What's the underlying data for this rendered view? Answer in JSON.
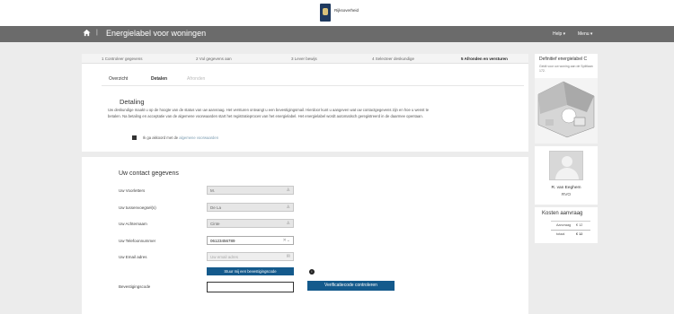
{
  "header": {
    "logo_text": "Rijksoverheid"
  },
  "nav": {
    "title": "Energielabel voor woningen",
    "separator": "|",
    "help": "Help ▾",
    "menu": "Menu ▾"
  },
  "steps": [
    "1 Controleer gegevens",
    "2 Vul gegevens aan",
    "3 Lever bewijs",
    "4 Selecteer deskundige",
    "5 Afronden en versturen"
  ],
  "tabs": {
    "overzicht": "Overzicht",
    "detalen": "Detalen",
    "afronden": "Afronden"
  },
  "detail": {
    "title": "Detaling",
    "text": "Uw deskundige maakt u op de hoogte van de status van uw aanvraag. Het versturen ontvangt u een bevestigingsmail. Hierdoor kunt u aangeven wat uw contactgegevens zijn en hoe u wenst te betalen. Na betaling en acceptatie van de algemene voorwaarden start het registratieproces van het energielabel. Het energielabel wordt automatisch geregistreerd in de daarmee opentaan.",
    "agree_prefix": "Ik ga akkoord met de",
    "agree_link": "algemene voorwaarden"
  },
  "contact": {
    "title": "Uw contact gegevens",
    "labels": {
      "voorletters": "Uw Voorletters",
      "tussenvoegsel": "Uw tussenvoegsel(s)",
      "achternaam": "Uw Achternaam",
      "telefoon": "Uw Telefoonnummer",
      "email": "Uw Email adres",
      "code": "Bevestigingscode"
    },
    "values": {
      "voorletters": "M.",
      "tussenvoegsel": "De La",
      "achternaam": "Cinte",
      "telefoon": "06123456789"
    },
    "email_placeholder": "Uw email adres",
    "send_button": "Stuur mij een bevestigingscode",
    "verify_button": "Verificatiecode controleren"
  },
  "sidebar": {
    "card_title": "Definitief energielabel C",
    "card_text": "Geldt voor uw woning aan de Splitlaan 172.",
    "adviseur_name": "R. van Eeghem",
    "adviseur_org": "RVO",
    "kosten_title": "Kosten aanvraag",
    "aanvraag_label": "Aanvraag",
    "aanvraag_value": "€ 12",
    "totaal_label": "totaal",
    "totaal_value": "€ 12"
  },
  "icons": [
    "home-icon",
    "person-icon",
    "clear-icon",
    "chevron-down-icon",
    "email-icon",
    "info-icon",
    "checkbox-icon"
  ],
  "colors": {
    "nav_bg": "#6b6b6b",
    "button_blue": "#145a8c",
    "page_bg": "#ececec"
  }
}
